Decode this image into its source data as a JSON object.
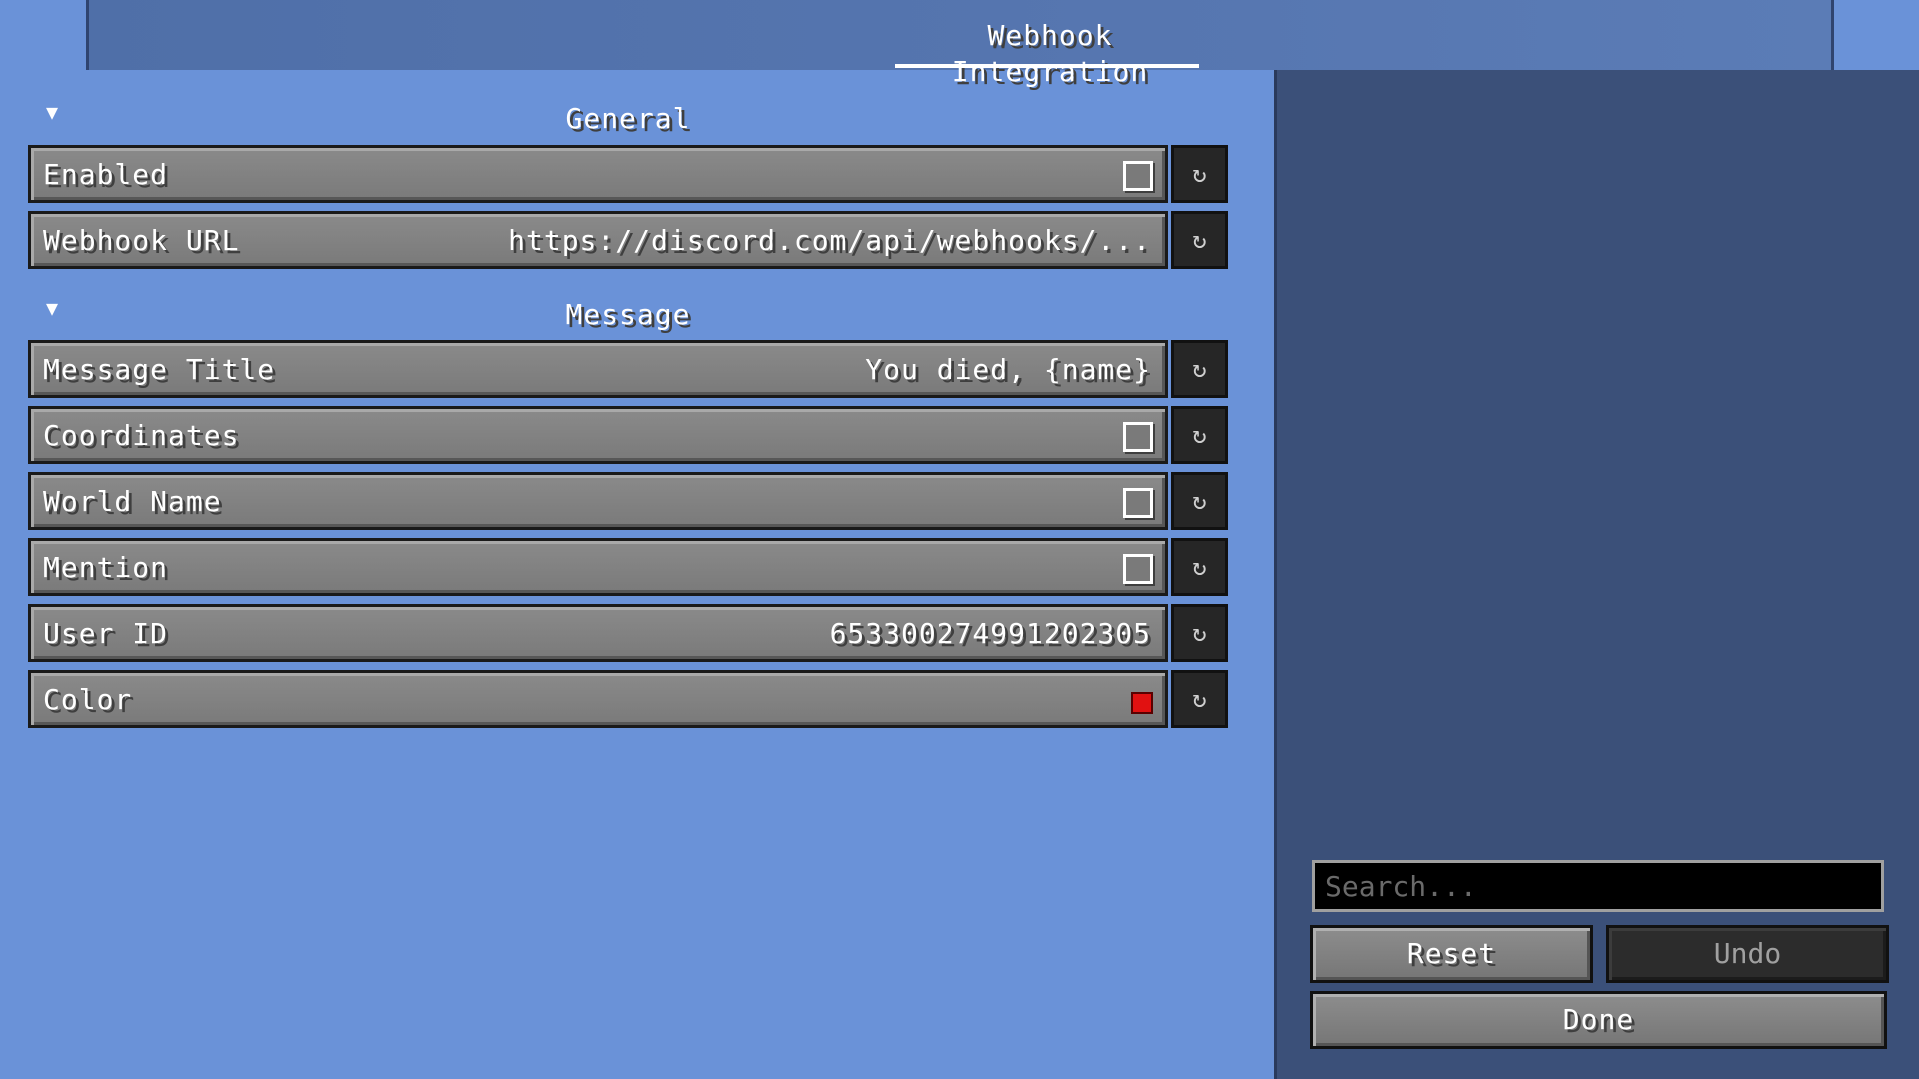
{
  "window": {
    "title": "Webhook Integration"
  },
  "sections": {
    "general": {
      "title": "General",
      "arrow_icon": "triangle-down-icon"
    },
    "message": {
      "title": "Message",
      "arrow_icon": "triangle-down-icon"
    }
  },
  "options": {
    "enabled": {
      "label": "Enabled",
      "checked": false
    },
    "webhook_url": {
      "label": "Webhook URL",
      "value": "https://discord.com/api/webhooks/..."
    },
    "message_title": {
      "label": "Message Title",
      "value": "You died, {name}"
    },
    "coordinates": {
      "label": "Coordinates",
      "checked": false
    },
    "world_name": {
      "label": "World Name",
      "checked": false
    },
    "mention": {
      "label": "Mention",
      "checked": false
    },
    "user_id": {
      "label": "User ID",
      "value": "653300274991202305"
    },
    "color": {
      "label": "Color",
      "swatch": "#e11111"
    }
  },
  "reset_icon": "↻",
  "search": {
    "placeholder": "Search...",
    "value": ""
  },
  "buttons": {
    "reset": "Reset",
    "undo": "Undo",
    "done": "Done"
  },
  "colors": {
    "background": "#6a92d8",
    "right_panel": "#3b5079",
    "row": "#7a7a7a",
    "reset_button": "#262626"
  }
}
